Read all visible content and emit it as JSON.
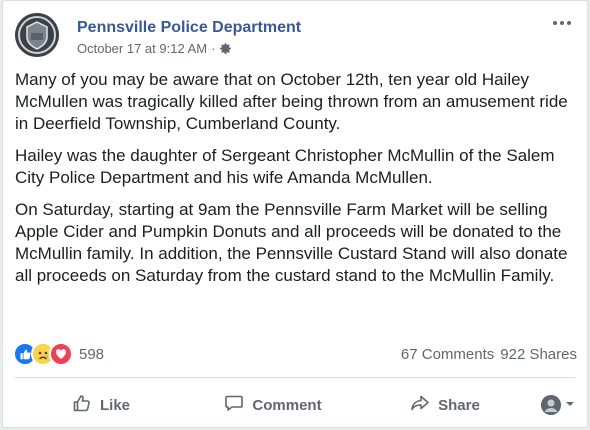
{
  "post": {
    "page_name": "Pennsville Police Department",
    "timestamp": "October 17 at 9:12 AM",
    "separator": "·",
    "audience_icon": "gear-icon",
    "paragraphs": [
      "Many of you may be aware that on October 12th, ten year old Hailey McMullen was tragically killed after being thrown from an amusement ride in Deerfield Township, Cumberland County.",
      "Hailey was the daughter of Sergeant Christopher McMullin of the Salem City Police Department and his wife Amanda McMullen.",
      "On Saturday, starting at 9am the Pennsville Farm Market will be selling Apple Cider and Pumpkin Donuts and all proceeds will be donated to the McMullin family. In addition, the Pennsville Custard Stand will also donate all proceeds on Saturday from the custard stand to the McMullin Family."
    ]
  },
  "stats": {
    "reaction_icons": [
      "like-reaction-icon",
      "sad-reaction-icon",
      "love-reaction-icon"
    ],
    "reaction_count": "598",
    "comments": "67 Comments",
    "shares": "922 Shares"
  },
  "actions": {
    "like": "Like",
    "comment": "Comment",
    "share": "Share"
  },
  "colors": {
    "link": "#385898",
    "text": "#1c1e21",
    "muted": "#606770",
    "like_blue": "#1877f2",
    "love_red": "#f33e58"
  }
}
